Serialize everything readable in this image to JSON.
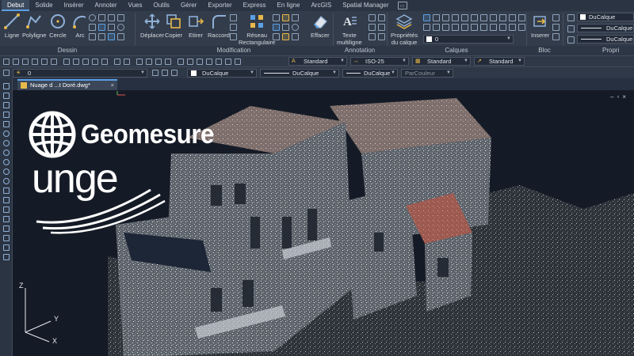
{
  "tabs": [
    "Debut",
    "Solide",
    "Insérer",
    "Annoter",
    "Vues",
    "Outils",
    "Gérer",
    "Exporter",
    "Express",
    "En ligne",
    "ArcGIS",
    "Spatial Manager"
  ],
  "active_tab": "Debut",
  "ribbon": {
    "dessin": {
      "label": "Dessin",
      "tools": [
        "Ligne",
        "Polyligne",
        "Cercle",
        "Arc"
      ]
    },
    "modification": {
      "label": "Modification",
      "tools": [
        "Déplacer",
        "Copier",
        "Etirer",
        "Raccord"
      ],
      "reseau": "Réseau",
      "reseau2": "Rectangulaire",
      "effacer": "Effacer"
    },
    "annotation": {
      "label": "Annotation",
      "texte": "Texte",
      "texte2": "multiligne"
    },
    "calques": {
      "label": "Calques",
      "proprietes": "Propriétés",
      "proprietes2": "du calque",
      "layer_value": "0"
    },
    "bloc": {
      "label": "Bloc",
      "inserer": "Inserer"
    },
    "proprietes_panel": {
      "label": "Propri",
      "color": "DuCalque",
      "linetype": "DuCalque",
      "lineweight": "DuCalque"
    }
  },
  "toolbar_row1": {
    "text_style": "Standard",
    "dim_style": "ISO-25",
    "table_style": "Standard",
    "multileader_style": "Standard"
  },
  "toolbar_row2": {
    "layer": "0",
    "color": "DuCalque",
    "linetype": "DuCalque",
    "lineweight": "DuCalque",
    "plotstyle": "ParCouleur"
  },
  "document_tab": "Nuage d ...t Doré.dwg*",
  "brands": {
    "primary": "Geomesure",
    "secondary": "unge"
  },
  "ucs": {
    "z": "Z",
    "y": "Y",
    "x": "X"
  },
  "colors": {
    "accent": "#5aa0e6",
    "background": "#1b2230"
  }
}
